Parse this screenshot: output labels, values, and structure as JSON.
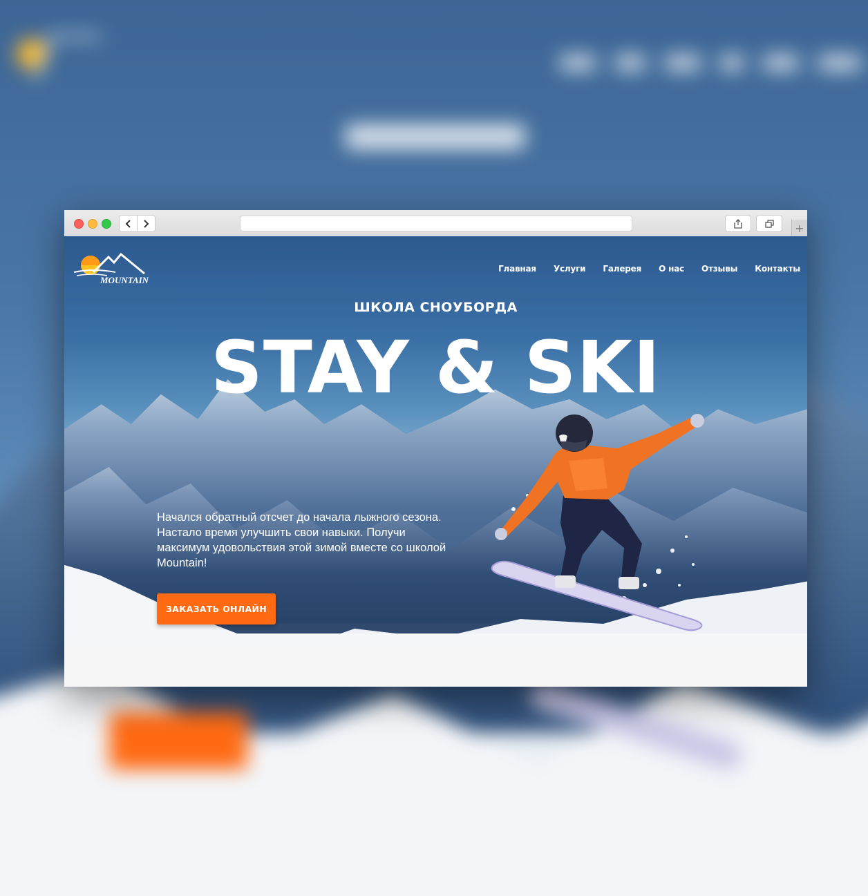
{
  "nav": {
    "items": [
      "Главная",
      "Услуги",
      "Галерея",
      "О нас",
      "Отзывы",
      "Контакты"
    ]
  },
  "logo": {
    "text": "MOUNTAIN"
  },
  "hero": {
    "subtitle": "ШКОЛА СНОУБОРДА",
    "headline": "STAY & SKI",
    "lead": "Начался обратный отсчет до начала лыжного сезона. Настало время улучшить свои навыки. Получи максимум удовольствия этой зимой вместе со школой Mountain!",
    "cta_label": "ЗАКАЗАТЬ ОНЛАЙН"
  },
  "browser": {
    "back_icon": "chevron-left-icon",
    "forward_icon": "chevron-right-icon",
    "new_tab_icon": "plus-icon"
  },
  "colors": {
    "accent": "#ff6a13",
    "sky": "#3b70a6"
  }
}
